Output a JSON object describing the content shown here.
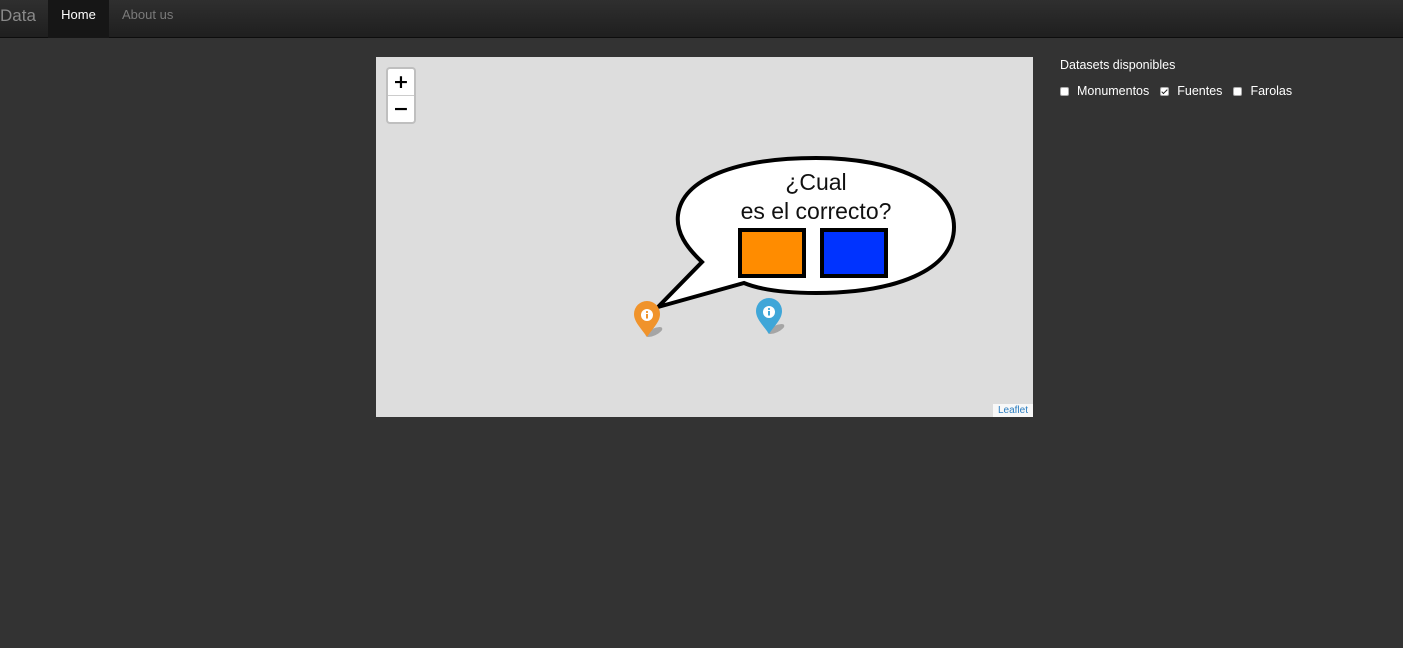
{
  "navbar": {
    "brand": "Data",
    "items": [
      {
        "label": "Home",
        "active": true
      },
      {
        "label": "About us",
        "active": false
      }
    ]
  },
  "map": {
    "zoom_in": "+",
    "zoom_out": "−",
    "attribution": "Leaflet",
    "bubble": {
      "line1": "¿Cual",
      "line2": "es el correcto?",
      "options": [
        {
          "color": "#ff8c00"
        },
        {
          "color": "#0033ff"
        }
      ]
    },
    "markers": [
      {
        "color": "#f0932b",
        "icon": "info-icon"
      },
      {
        "color": "#3fa6d8",
        "icon": "info-icon"
      }
    ]
  },
  "panel": {
    "title": "Datasets disponibles",
    "datasets": [
      {
        "label": "Monumentos",
        "checked": false
      },
      {
        "label": "Fuentes",
        "checked": true
      },
      {
        "label": "Farolas",
        "checked": false
      }
    ]
  }
}
